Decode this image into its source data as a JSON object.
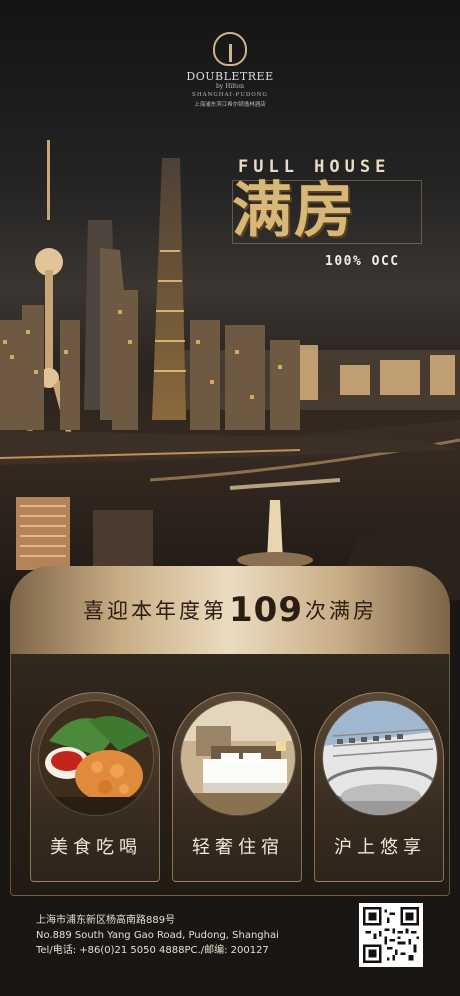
{
  "colors": {
    "gold": "#d7b878",
    "banner_dark": "#7d6447",
    "banner_light": "#ebdcc0",
    "panel": "#2a2219"
  },
  "logo": {
    "brand": "DOUBLETREE",
    "by": "by Hilton",
    "location": "SHANGHAI-PUDONG",
    "cn_name": "上海浦东滨江希尔顿逸林酒店",
    "icon": "tree-icon"
  },
  "headline": {
    "en": "FULL HOUSE",
    "cn": "满房",
    "occ": "100% OCC"
  },
  "banner": {
    "prefix": "喜迎本年度第",
    "count": "109",
    "suffix": "次满房"
  },
  "features": [
    {
      "label": "美食吃喝",
      "icon": "food-photo"
    },
    {
      "label": "轻奢住宿",
      "icon": "bedroom-photo"
    },
    {
      "label": "沪上悠享",
      "icon": "atrium-photo"
    }
  ],
  "address": {
    "cn": "上海市浦东新区杨高南路889号",
    "en": "No.889 South Yang Gao Road, Pudong, Shanghai",
    "contact": "Tel/电话: +86(0)21 5050 4888PC./邮编: 200127"
  },
  "qr": {
    "icon": "qr-code-icon"
  }
}
